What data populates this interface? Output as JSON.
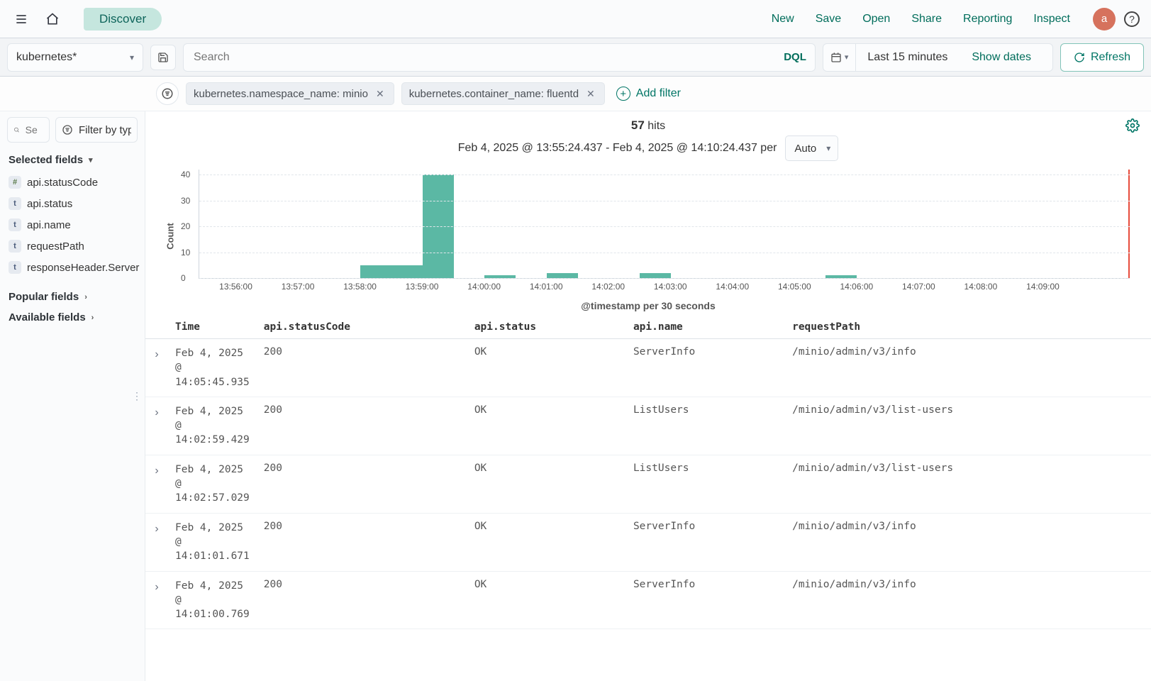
{
  "topnav": {
    "page_tab": "Discover",
    "links": [
      "New",
      "Save",
      "Open",
      "Share",
      "Reporting",
      "Inspect"
    ],
    "avatar_letter": "a"
  },
  "querybar": {
    "index_pattern": "kubernetes*",
    "search_placeholder": "Search",
    "dql_label": "DQL",
    "date_range": "Last 15 minutes",
    "show_dates": "Show dates",
    "refresh": "Refresh"
  },
  "filters": {
    "pills": [
      {
        "label": "kubernetes.namespace_name: minio"
      },
      {
        "label": "kubernetes.container_name: fluentd"
      }
    ],
    "add_filter": "Add filter"
  },
  "sidebar": {
    "search_placeholder": "Se",
    "filter_placeholder": "Filter by typ",
    "selected_title": "Selected fields",
    "selected_fields": [
      {
        "type": "#",
        "name": "api.statusCode"
      },
      {
        "type": "t",
        "name": "api.status"
      },
      {
        "type": "t",
        "name": "api.name"
      },
      {
        "type": "t",
        "name": "requestPath"
      },
      {
        "type": "t",
        "name": "responseHeader.Server"
      }
    ],
    "popular_title": "Popular fields",
    "available_title": "Available fields"
  },
  "hits": {
    "count": "57",
    "label": "hits"
  },
  "chart_range": "Feb 4, 2025 @ 13:55:24.437 - Feb 4, 2025 @ 14:10:24.437 per",
  "interval": "Auto",
  "x_axis_title": "@timestamp per 30 seconds",
  "y_axis_title": "Count",
  "chart_data": {
    "type": "bar",
    "xlabel": "@timestamp per 30 seconds",
    "ylabel": "Count",
    "ylim": [
      0,
      42
    ],
    "y_ticks": [
      0,
      10,
      20,
      30,
      40
    ],
    "x_ticks": [
      "13:56:00",
      "13:57:00",
      "13:58:00",
      "13:59:00",
      "14:00:00",
      "14:01:00",
      "14:02:00",
      "14:03:00",
      "14:04:00",
      "14:05:00",
      "14:06:00",
      "14:07:00",
      "14:08:00",
      "14:09:00"
    ],
    "x_range_minutes": [
      55.4,
      70.4
    ],
    "bars": [
      {
        "start_min": 58.0,
        "count": 5
      },
      {
        "start_min": 58.5,
        "count": 5
      },
      {
        "start_min": 59.0,
        "count": 40
      },
      {
        "start_min": 60.0,
        "count": 1
      },
      {
        "start_min": 61.0,
        "count": 2
      },
      {
        "start_min": 62.5,
        "count": 2
      },
      {
        "start_min": 65.5,
        "count": 1
      }
    ]
  },
  "table": {
    "headers": [
      "Time",
      "api.statusCode",
      "api.status",
      "api.name",
      "requestPath"
    ],
    "rows": [
      {
        "time": "Feb 4, 2025 @ 14:05:45.935",
        "code": "200",
        "status": "OK",
        "name": "ServerInfo",
        "path": "/minio/admin/v3/info"
      },
      {
        "time": "Feb 4, 2025 @ 14:02:59.429",
        "code": "200",
        "status": "OK",
        "name": "ListUsers",
        "path": "/minio/admin/v3/list-users"
      },
      {
        "time": "Feb 4, 2025 @ 14:02:57.029",
        "code": "200",
        "status": "OK",
        "name": "ListUsers",
        "path": "/minio/admin/v3/list-users"
      },
      {
        "time": "Feb 4, 2025 @ 14:01:01.671",
        "code": "200",
        "status": "OK",
        "name": "ServerInfo",
        "path": "/minio/admin/v3/info"
      },
      {
        "time": "Feb 4, 2025 @ 14:01:00.769",
        "code": "200",
        "status": "OK",
        "name": "ServerInfo",
        "path": "/minio/admin/v3/info"
      }
    ]
  }
}
